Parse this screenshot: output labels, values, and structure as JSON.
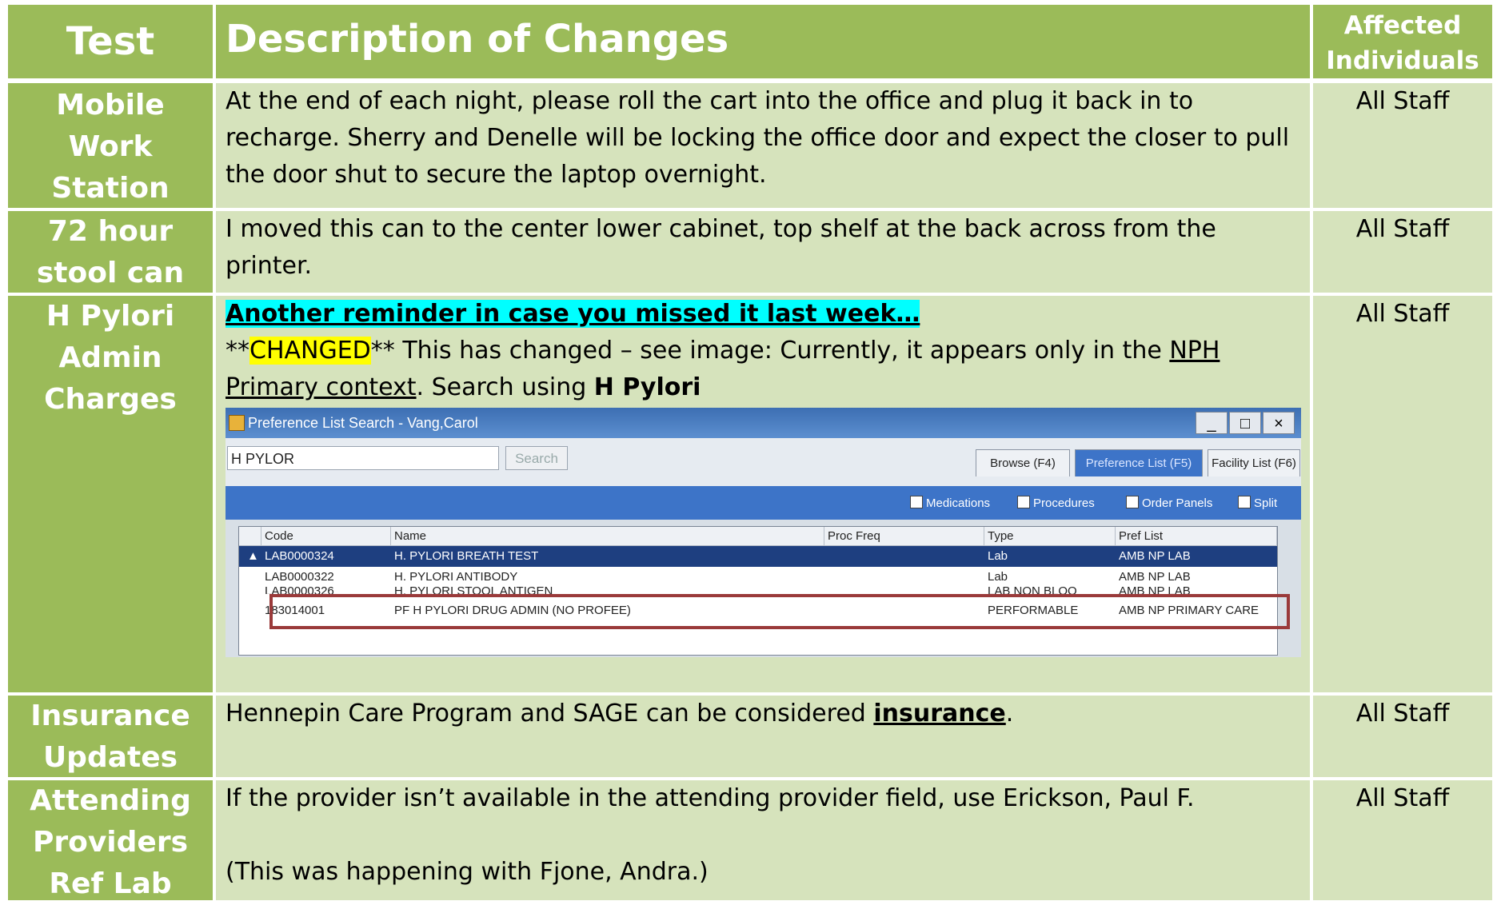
{
  "header": {
    "test": "Test",
    "description": "Description of Changes",
    "affected_line1": "Affected",
    "affected_line2": "Individuals"
  },
  "rows": [
    {
      "test_lines": [
        "Mobile",
        "Work",
        "Station"
      ],
      "description": "At the end of each night, please roll the cart into the office and plug it back in to recharge.  Sherry and Denelle will be locking the office door and expect the closer to pull the door shut to secure the laptop overnight.",
      "affected": "All Staff"
    },
    {
      "test_lines": [
        "72 hour",
        "stool can"
      ],
      "description": "I moved this can to the center lower cabinet, top shelf at the back across from the printer.",
      "affected": "All Staff"
    },
    {
      "test_lines": [
        "H Pylori",
        "Admin",
        "Charges"
      ],
      "reminder": "Another reminder in case you missed it last week…",
      "changed_prefix": "**",
      "changed_word": "CHANGED",
      "changed_suffix": "** This has changed – see image:  Currently, it appears only in the ",
      "context_link": "NPH Primary context",
      "search_prefix": ".  Search using ",
      "search_term": "H Pylori",
      "affected": "All Staff"
    },
    {
      "test_lines": [
        "Insurance",
        "Updates"
      ],
      "description_prefix": "Hennepin Care Program and SAGE can be considered ",
      "description_bold": "insurance",
      "description_suffix": ".",
      "affected": "All Staff"
    },
    {
      "test_lines": [
        "Attending",
        "Providers",
        "Ref Lab"
      ],
      "line1": "If the provider isn’t available in the attending provider field, use Erickson, Paul F.",
      "line2": "(This was happening with Fjone, Andra.)",
      "affected": "All Staff"
    }
  ],
  "screenshot": {
    "window_title": "Preference List Search - Vang,Carol",
    "buttons": [
      "_",
      "□",
      "×"
    ],
    "search_value": "H PYLOR",
    "search_button": "Search",
    "tabs": [
      "Browse (F4)",
      "Preference List (F5)",
      "Facility List (F6)"
    ],
    "active_tab": "Preference List (F5)",
    "filters": [
      "Medications",
      "Procedures",
      "Order Panels",
      "Split"
    ],
    "columns": [
      "Code",
      "Name",
      "Proc Freq",
      "Type",
      "Pref List"
    ],
    "grid_rows": [
      {
        "code": "LAB0000324",
        "name": "H. PYLORI BREATH TEST",
        "freq": "",
        "type": "Lab",
        "pref": "AMB NP LAB",
        "selected": true
      },
      {
        "code": "LAB0000322",
        "name": "H. PYLORI ANTIBODY",
        "freq": "",
        "type": "Lab",
        "pref": "AMB NP LAB",
        "selected": false
      },
      {
        "code": "LAB0000326",
        "name": "H. PYLORI STOOL ANTIGEN",
        "freq": "",
        "type": "LAB NON BLOO",
        "pref": "AMB NP LAB",
        "selected": false
      },
      {
        "code": "183014001",
        "name": "PF H PYLORI DRUG ADMIN (NO PROFEE)",
        "freq": "",
        "type": "PERFORMABLE",
        "pref": "AMB NP PRIMARY CARE",
        "selected": false
      }
    ]
  },
  "colors": {
    "header_green": "#9bbb59",
    "row_light_green": "#d6e3bc",
    "highlight_cyan": "#00ffff",
    "highlight_yellow": "#ffff00",
    "callout_red": "#9a3a3a"
  }
}
